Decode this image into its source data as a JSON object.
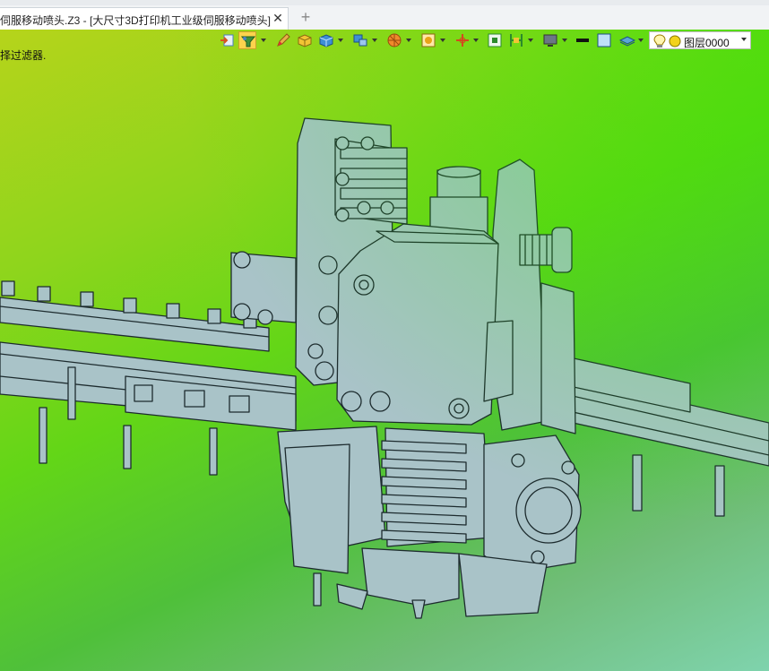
{
  "tab": {
    "title": "伺服移动喷头.Z3 - [大尺寸3D打印机工业级伺服移动喷头]",
    "close_glyph": "✕",
    "new_glyph": "+"
  },
  "viewport": {
    "status_text": "择过滤器.",
    "background": {
      "top_left": "#b6d41b",
      "top_right": "#3be400",
      "bottom_left": "#7fd3ad",
      "bottom_right": "#70a85a"
    },
    "model_color": "#a9c3c8"
  },
  "toolbar": {
    "icons": [
      "import-icon",
      "filter-icon",
      "pencil-icon",
      "box-icon",
      "cube-icon",
      "multi-shape-icon",
      "ball-icon",
      "render-icon",
      "axis-icon",
      "select-frame-icon",
      "bracket-icon",
      "monitor-icon",
      "line-color-icon",
      "fill-color-icon",
      "layer-stack-icon"
    ],
    "layer": {
      "label": "图层0000",
      "icons": [
        "bulb-icon",
        "circle-icon"
      ]
    }
  }
}
